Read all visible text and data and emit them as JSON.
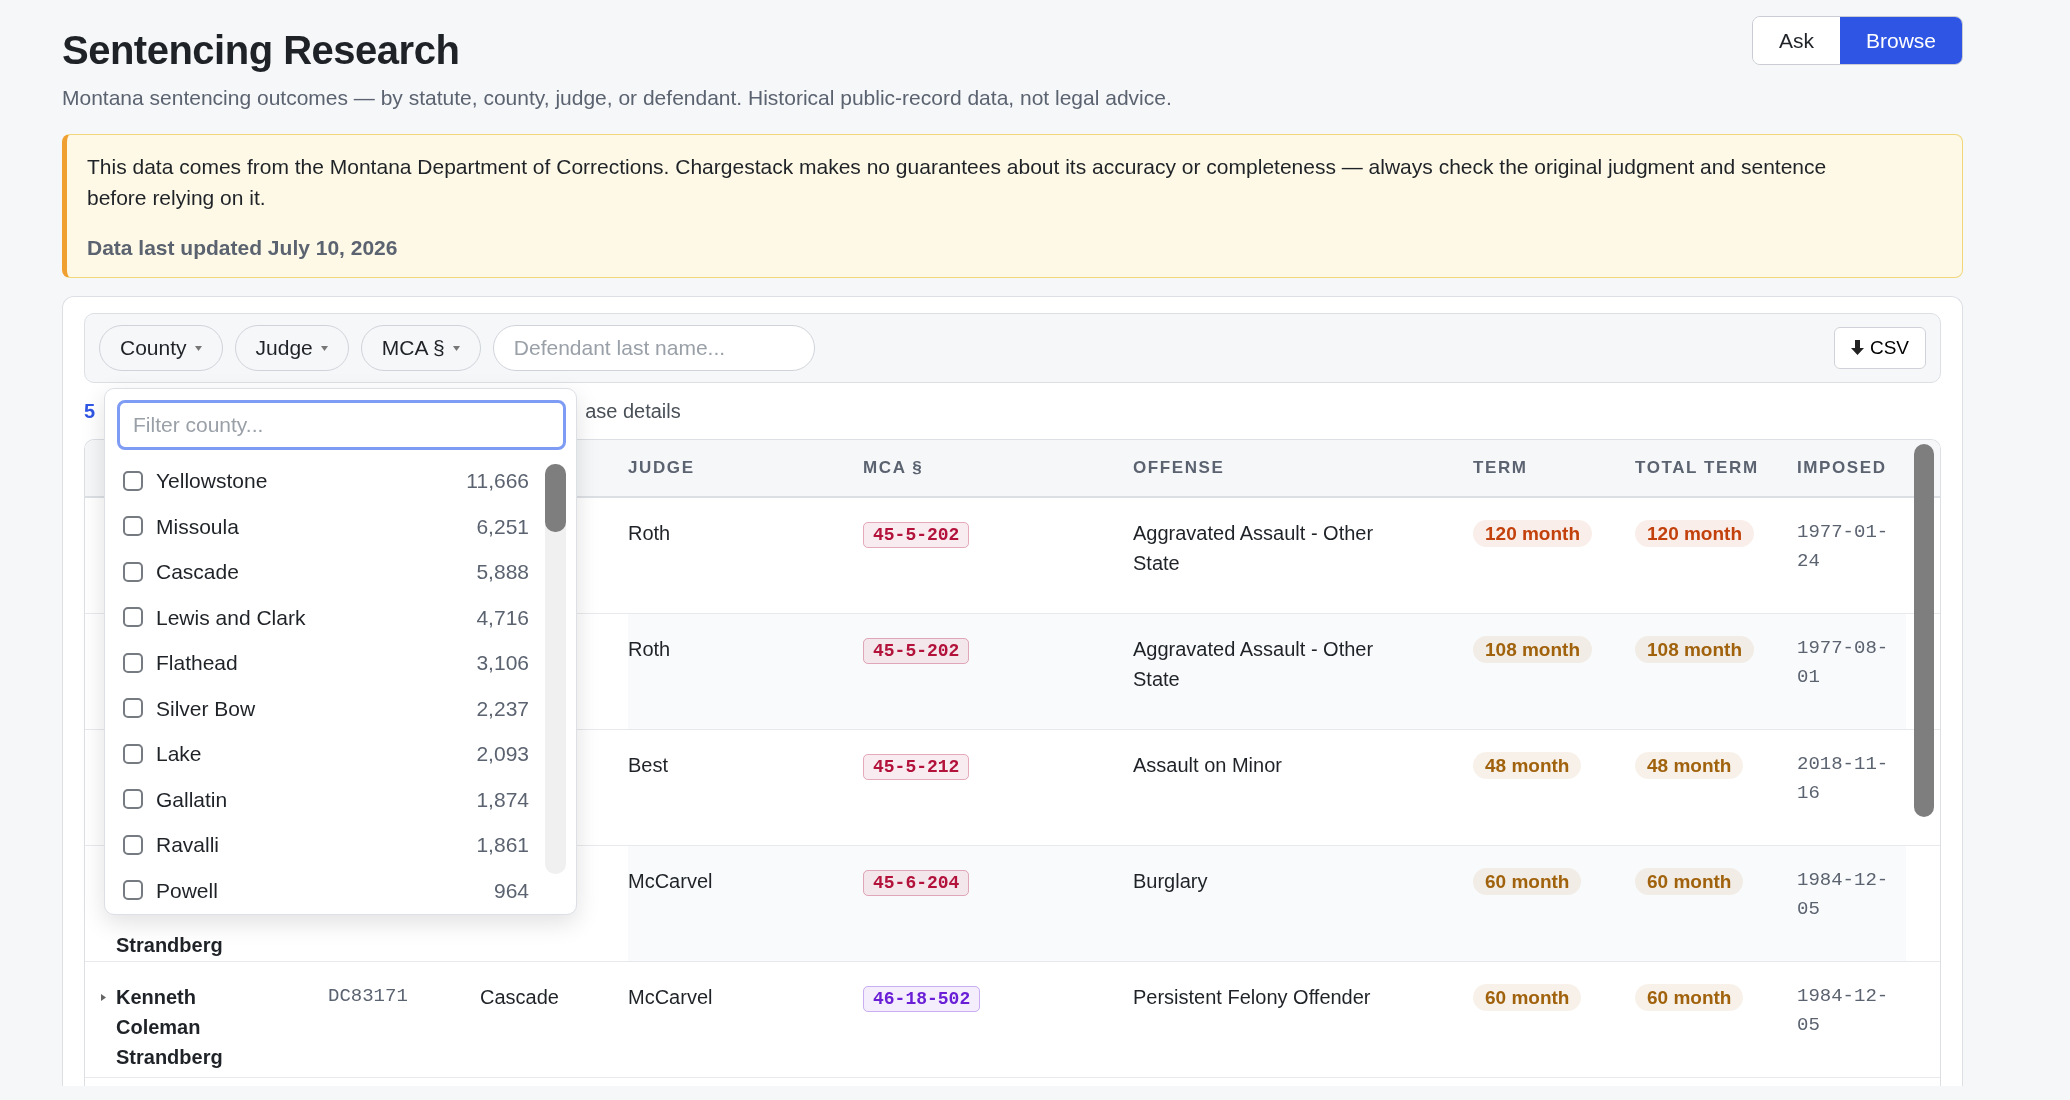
{
  "header": {
    "title": "Sentencing Research",
    "subtitle": "Montana sentencing outcomes — by statute, county, judge, or defendant. Historical public-record data, not legal advice."
  },
  "mode_tabs": [
    {
      "label": "Ask",
      "selected": false
    },
    {
      "label": "Browse",
      "selected": true
    }
  ],
  "notice": {
    "text": "This data comes from the Montana Department of Corrections. Chargestack makes no guarantees about its accuracy or completeness — always check the original judgment and sentence before relying on it.",
    "updated": "Data last updated July 10, 2026"
  },
  "filters": [
    {
      "label": "County"
    },
    {
      "label": "Judge"
    },
    {
      "label": "MCA §"
    }
  ],
  "defendant_search": {
    "placeholder": "Defendant last name..."
  },
  "export_button": {
    "label": "CSV"
  },
  "result_summary": {
    "count": "5",
    "details": "ase details"
  },
  "county_dropdown": {
    "placeholder": "Filter county...",
    "items": [
      {
        "name": "Yellowstone",
        "count": "11,666",
        "checked": false
      },
      {
        "name": "Missoula",
        "count": "6,251",
        "checked": false
      },
      {
        "name": "Cascade",
        "count": "5,888",
        "checked": false
      },
      {
        "name": "Lewis and Clark",
        "count": "4,716",
        "checked": false
      },
      {
        "name": "Flathead",
        "count": "3,106",
        "checked": false
      },
      {
        "name": "Silver Bow",
        "count": "2,237",
        "checked": false
      },
      {
        "name": "Lake",
        "count": "2,093",
        "checked": false
      },
      {
        "name": "Gallatin",
        "count": "1,874",
        "checked": false
      },
      {
        "name": "Ravalli",
        "count": "1,861",
        "checked": false
      },
      {
        "name": "Powell",
        "count": "964",
        "checked": false
      }
    ]
  },
  "table": {
    "columns": [
      "JUDGE",
      "MCA §",
      "OFFENSE",
      "TERM",
      "TOTAL TERM",
      "IMPOSED"
    ],
    "rows": [
      {
        "judge": "Roth",
        "statute": {
          "code": "45-5-202",
          "color": "#b3123b"
        },
        "offense": "Aggravated Assault - Other State",
        "term": {
          "text": "120 month",
          "color": "#c2410c"
        },
        "total_term": {
          "text": "120 month",
          "color": "#c2410c"
        },
        "imposed": "1977-01-24"
      },
      {
        "judge": "Roth",
        "statute": {
          "code": "45-5-202",
          "color": "#b3123b"
        },
        "offense": "Aggravated Assault - Other State",
        "term": {
          "text": "108 month",
          "color": "#a1620d"
        },
        "total_term": {
          "text": "108 month",
          "color": "#a1620d"
        },
        "imposed": "1977-08-01"
      },
      {
        "judge": "Best",
        "statute": {
          "code": "45-5-212",
          "color": "#b3123b"
        },
        "offense": "Assault on Minor",
        "term": {
          "text": "48 month",
          "color": "#a1620d"
        },
        "total_term": {
          "text": "48 month",
          "color": "#a1620d"
        },
        "imposed": "2018-11-16"
      },
      {
        "defendant": "Strandberg",
        "judge": "McCarvel",
        "statute": {
          "code": "45-6-204",
          "color": "#b3123b"
        },
        "offense": "Burglary",
        "term": {
          "text": "60 month",
          "color": "#a1620d"
        },
        "total_term": {
          "text": "60 month",
          "color": "#a1620d"
        },
        "imposed": "1984-12-05"
      },
      {
        "defendant": "Kenneth Coleman Strandberg",
        "expandable": true,
        "case": "DC83171",
        "county": "Cascade",
        "judge": "McCarvel",
        "statute": {
          "code": "46-18-502",
          "color": "#6a1fd6"
        },
        "offense": "Persistent Felony Offender",
        "term": {
          "text": "60 month",
          "color": "#a1620d"
        },
        "total_term": {
          "text": "60 month",
          "color": "#a1620d"
        },
        "imposed": "1984-12-05"
      }
    ]
  }
}
